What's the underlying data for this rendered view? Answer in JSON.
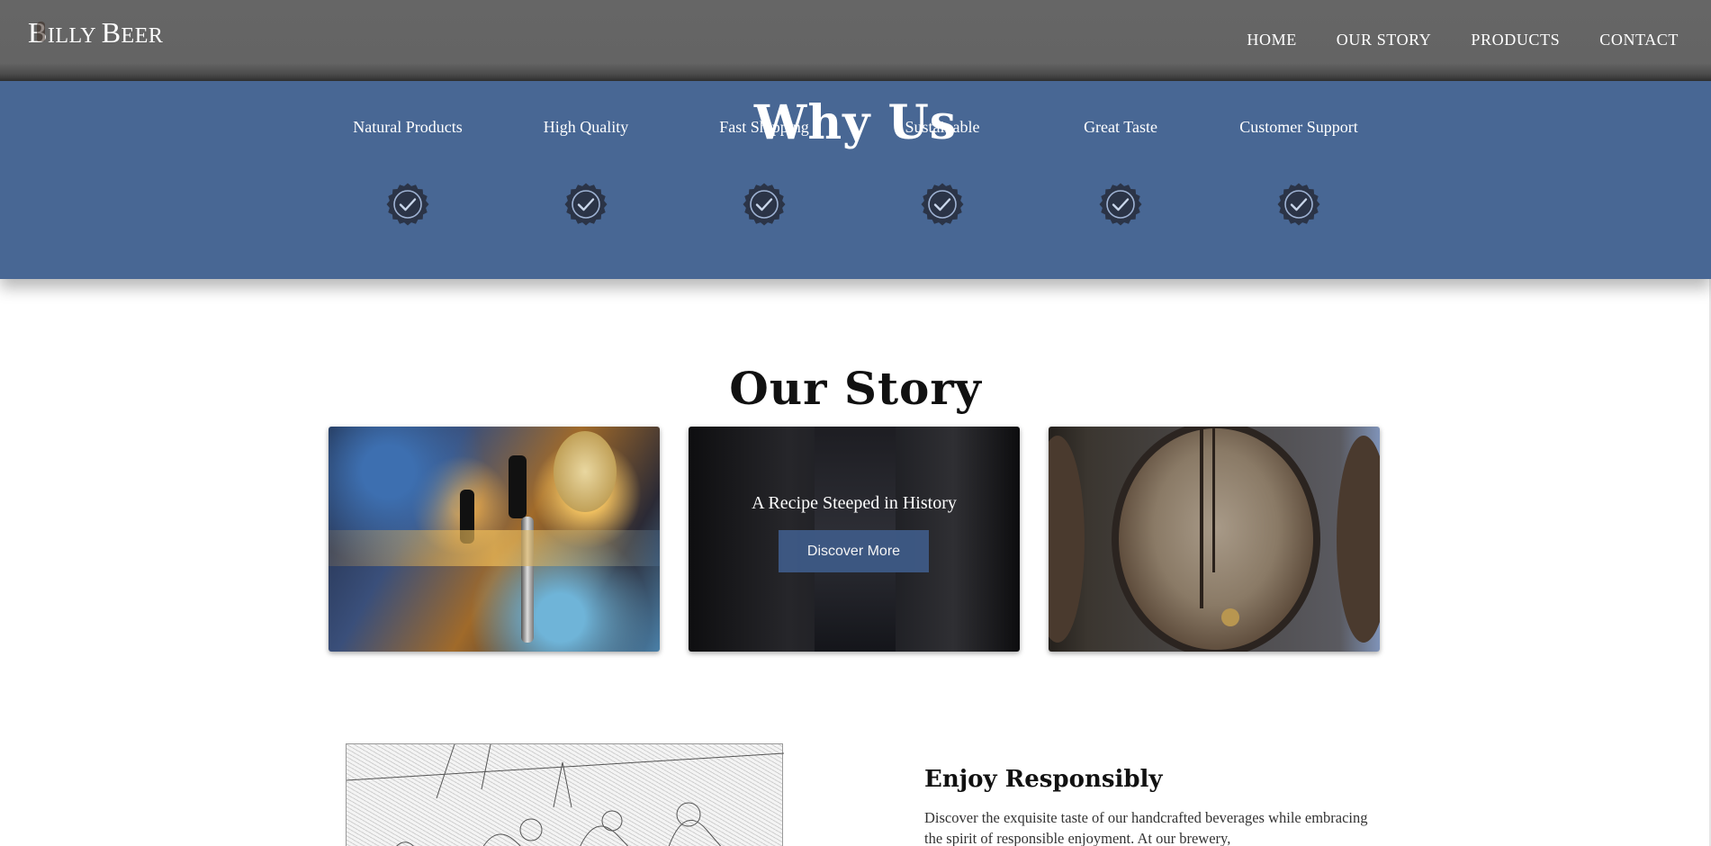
{
  "header": {
    "logo_b": "B",
    "logo_rest1": "ILLY ",
    "logo_b2": "B",
    "logo_rest2": "EER",
    "nav": [
      "HOME",
      "OUR STORY",
      "PRODUCTS",
      "CONTACT"
    ]
  },
  "why_us": {
    "title": "Why Us",
    "features": [
      "Natural Products",
      "High Quality",
      "Fast Shipping",
      "Sustainable",
      "Great Taste",
      "Customer Support"
    ],
    "badge_icon": "check-badge-icon"
  },
  "our_story": {
    "title": "Our Story",
    "card_caption": "A Recipe Steeped in History",
    "discover_label": "Discover More"
  },
  "enjoy": {
    "title": "Enjoy Responsibly",
    "text": "Discover the exquisite taste of our handcrafted beverages while embracing the spirit of responsible enjoyment. At our brewery,"
  },
  "colors": {
    "header_bg": "#646464",
    "band_bg": "#486794",
    "badge": "#2b3447",
    "button": "#3e5a86"
  }
}
